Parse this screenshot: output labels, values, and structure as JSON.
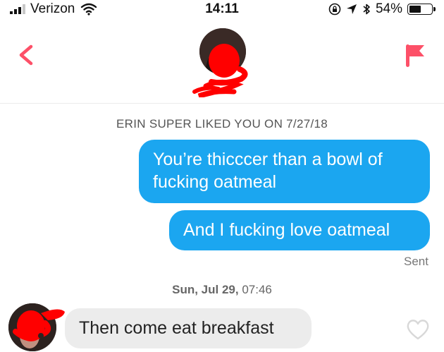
{
  "status_bar": {
    "carrier": "Verizon",
    "time": "14:11",
    "battery": "54%",
    "battery_level": 0.54,
    "icons": [
      "signal-icon",
      "wifi-icon",
      "screen-lock-icon",
      "location-icon",
      "bluetooth-icon",
      "battery-icon"
    ]
  },
  "header": {
    "back_icon": "chevron-left-icon",
    "report_icon": "flag-icon",
    "accent_color": "#fd5068"
  },
  "conversation": {
    "super_like_notice": "ERIN SUPER LIKED YOU ON 7/27/18",
    "outgoing": [
      {
        "text": "You’re thicccer than a bowl of fucking oatmeal"
      },
      {
        "text": "And I fucking love oatmeal"
      }
    ],
    "sent_status": "Sent",
    "timestamp_date": "Sun, Jul 29,",
    "timestamp_time": "07:46",
    "incoming": [
      {
        "text": "Then come eat breakfast",
        "like_icon": "heart-icon"
      }
    ],
    "outgoing_bubble_color": "#1ba6f0",
    "incoming_bubble_color": "#ececec",
    "redaction_color": "#ff0000"
  }
}
